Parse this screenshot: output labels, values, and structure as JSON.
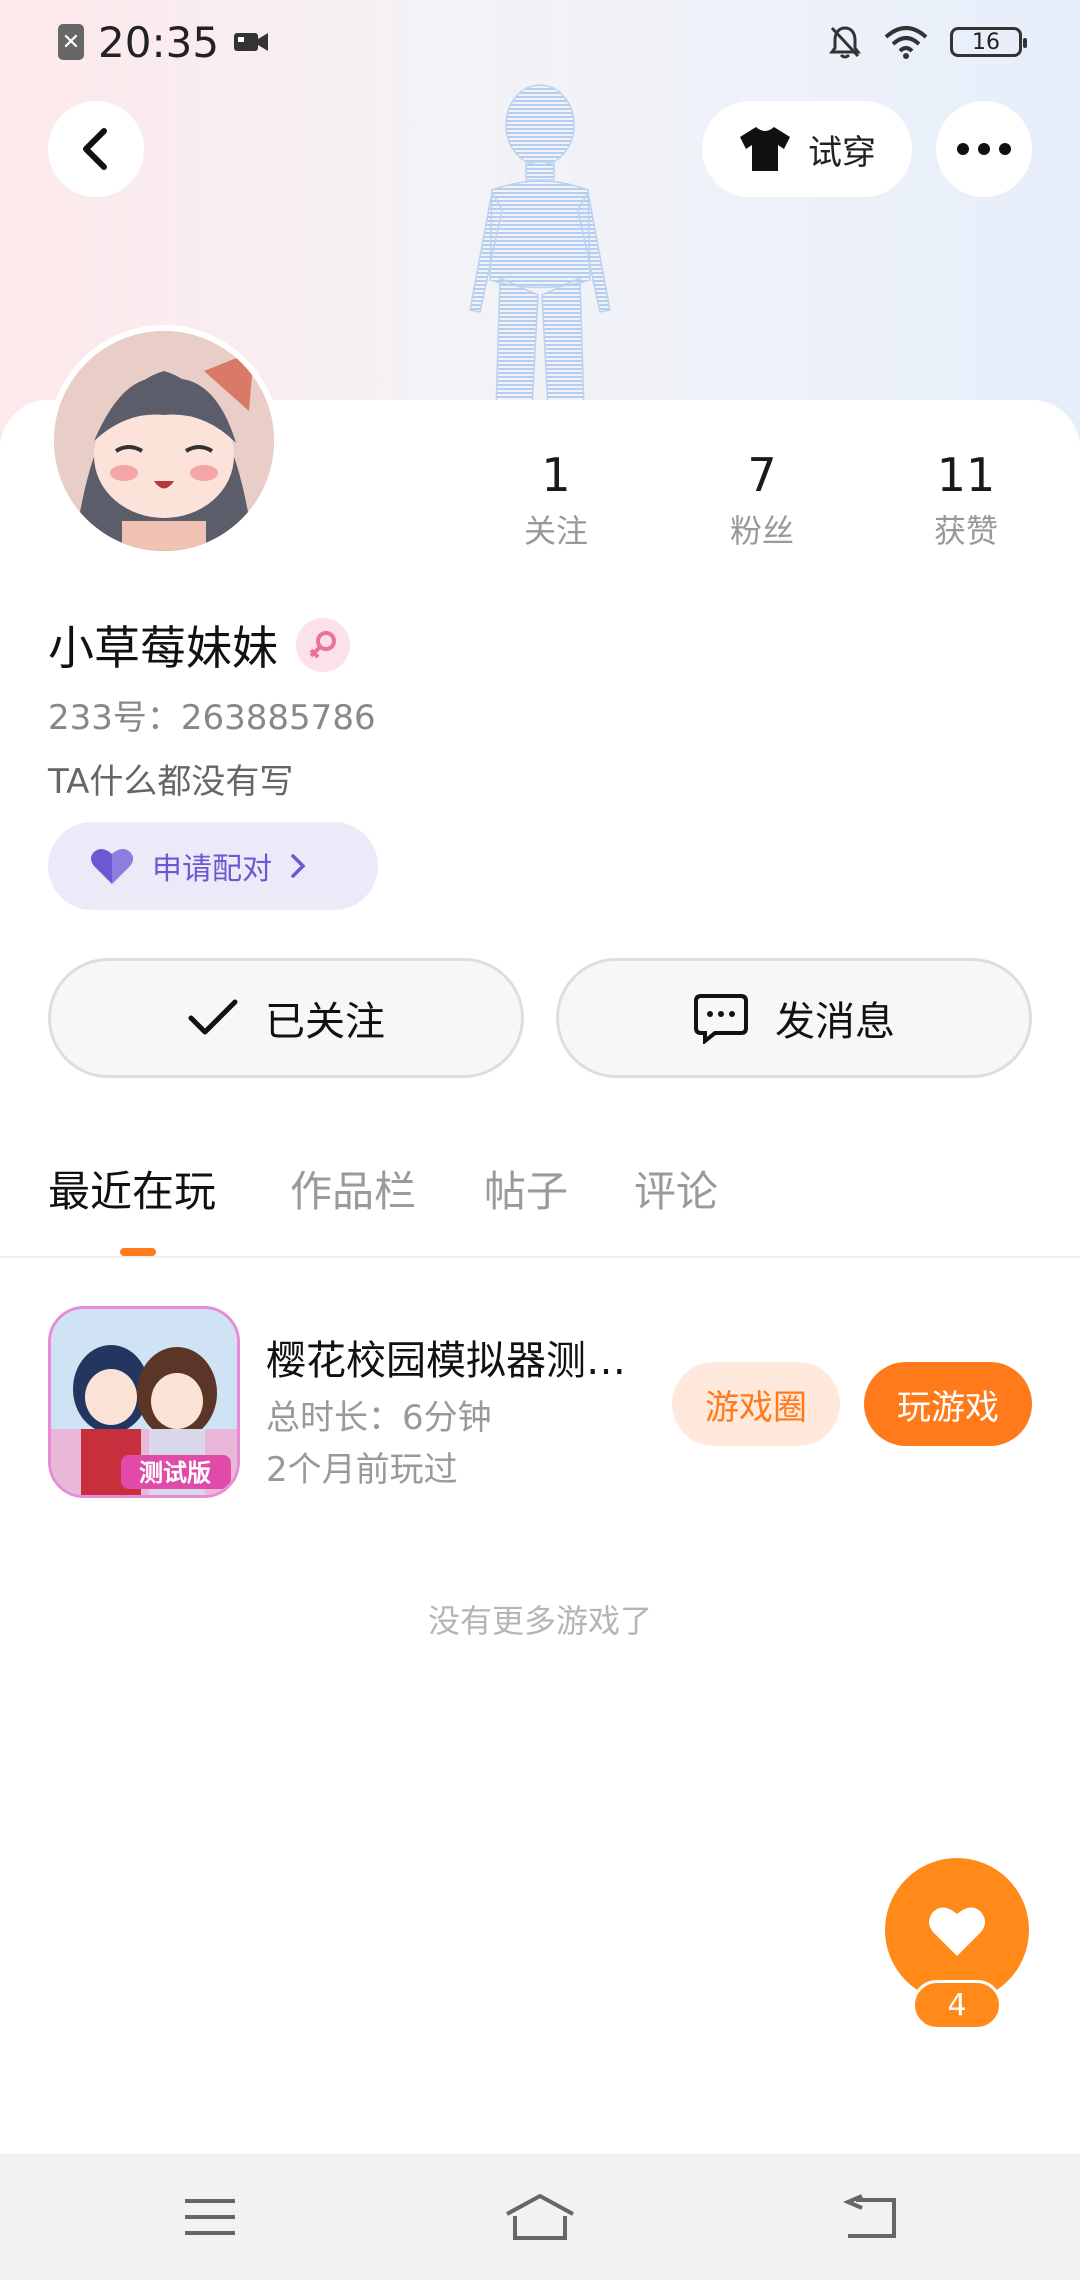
{
  "status_bar": {
    "time": "20:35",
    "battery": "16",
    "icons": [
      "sim-icon",
      "video-icon",
      "mute-bell-icon",
      "wifi-icon",
      "battery-icon"
    ]
  },
  "header": {
    "tryon_label": "试穿"
  },
  "profile": {
    "stats": [
      {
        "value": "1",
        "label": "关注"
      },
      {
        "value": "7",
        "label": "粉丝"
      },
      {
        "value": "11",
        "label": "获赞"
      }
    ],
    "nickname": "小草莓妹妹",
    "uid": "233号：263885786",
    "bio": "TA什么都没有写",
    "match_label": "申请配对"
  },
  "actions": {
    "followed_label": "已关注",
    "message_label": "发消息"
  },
  "tabs": [
    "最近在玩",
    "作品栏",
    "帖子",
    "评论"
  ],
  "games": [
    {
      "title": "樱花校园模拟器测…",
      "duration": "总时长：6分钟",
      "last_played": "2个月前玩过",
      "icon_badge": "测试版",
      "circle_label": "游戏圈",
      "play_label": "玩游戏"
    }
  ],
  "list_footer": "没有更多游戏了",
  "like": {
    "count": "4"
  },
  "colors": {
    "accent": "#ff7a1a",
    "match_purple": "#6c59d1",
    "like_orange": "#ff8a1a"
  }
}
